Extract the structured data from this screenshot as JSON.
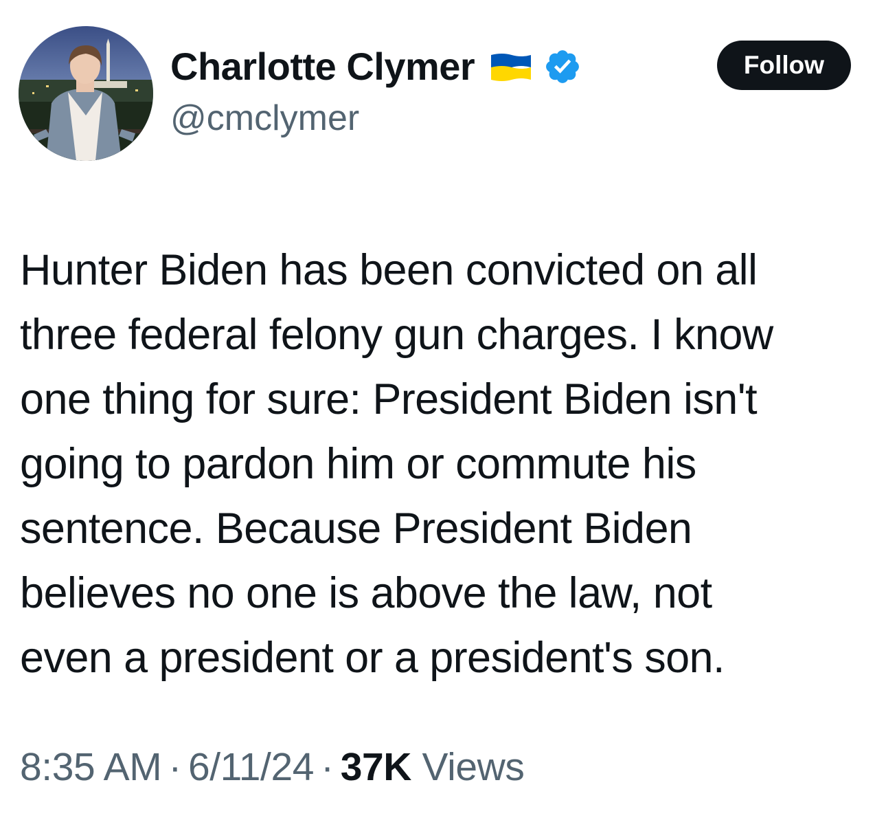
{
  "author": {
    "display_name": "Charlotte Clymer",
    "handle": "@cmclymer",
    "flag_icon": "ukraine-flag-icon",
    "verified_icon": "verified-badge-icon",
    "verified_color": "#1d9bf0"
  },
  "follow_button": {
    "label": "Follow"
  },
  "tweet": {
    "text": "Hunter Biden has been convicted on all\nthree federal felony gun charges. I know\none thing for sure: President Biden isn't\ngoing to pardon him or commute his\nsentence. Because President Biden\nbelieves no one is above the law, not\neven a president or a president's son."
  },
  "meta": {
    "time": "8:35 AM",
    "separator": "·",
    "date": "6/11/24",
    "views_count": "37K",
    "views_label": "Views"
  },
  "colors": {
    "text": "#0f1419",
    "secondary_text": "#536471",
    "button_bg": "#0f1419",
    "flag_blue": "#0057b7",
    "flag_yellow": "#ffd700"
  }
}
